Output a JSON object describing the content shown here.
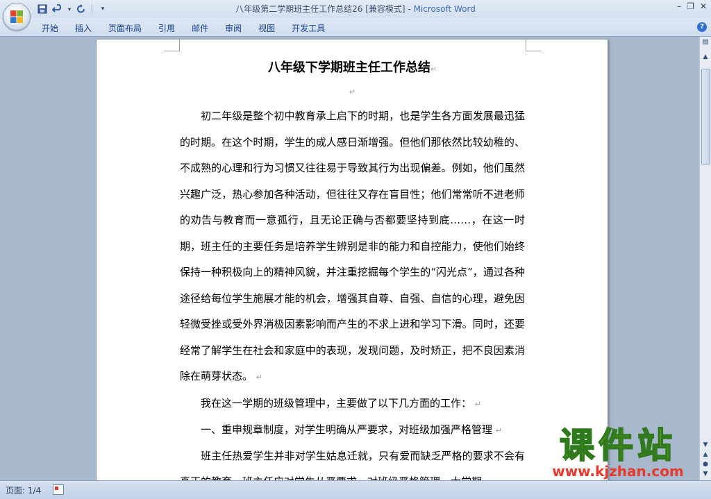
{
  "window": {
    "title_doc": "八年级第二学期班主任工作总结26 [兼容模式] - ",
    "title_app": "Microsoft Word"
  },
  "ribbon": {
    "tabs": [
      {
        "label": "开始"
      },
      {
        "label": "插入"
      },
      {
        "label": "页面布局"
      },
      {
        "label": "引用"
      },
      {
        "label": "邮件"
      },
      {
        "label": "审阅"
      },
      {
        "label": "视图"
      },
      {
        "label": "开发工具"
      }
    ],
    "help_label": "?"
  },
  "document": {
    "title": "八年级下学期班主任工作总结",
    "paragraphs": [
      "初二年级是整个初中教育承上启下的时期，也是学生各方面发展最迅猛的时期。在这个时期，学生的成人感日渐增强。但他们那依然比较幼稚的、不成熟的心理和行为习惯又往往易于导致其行为出现偏差。例如，他们虽然兴趣广泛，热心参加各种活动，但往往又存在盲目性；他们常常听不进老师的劝告与教育而一意孤行，且无论正确与否都要坚持到底……，在这一时期，班主任的主要任务是培养学生辨别是非的能力和自控能力，使他们始终保持一种积极向上的精神风貌，并注重挖掘每个学生的“闪光点”，通过各种途径给每位学生施展才能的机会，增强其自尊、自强、自信的心理，避免因轻微受挫或受外界消极因素影响而产生的不求上进和学习下滑。同时，还要经常了解学生在社会和家庭中的表现，发现问题，及时矫正，把不良因素消除在萌芽状态。",
      "我在这一学期的班级管理中，主要做了以下几方面的工作：",
      "一、重申规章制度，对学生明确从严要求，对班级加强严格管理",
      "班主任热爱学生并非对学生姑息迁就，只有爱而缺乏严格的要求不会有真正的教育。班主任应对学生从严要求，对班级严格管理，大学期"
    ]
  },
  "statusbar": {
    "page_info": "页面: 1/4"
  },
  "watermark": {
    "title": "课件站",
    "url": "www.kjzhan.com"
  }
}
